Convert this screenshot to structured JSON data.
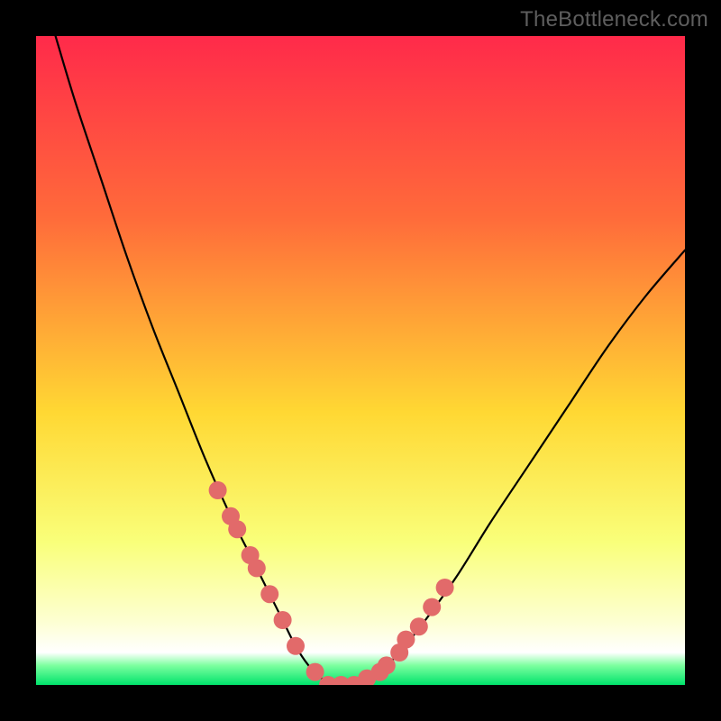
{
  "watermark": {
    "text": "TheBottleneck.com"
  },
  "colors": {
    "black": "#000000",
    "curve": "#000000",
    "marker_fill": "#e26a6a",
    "marker_stroke": "#d45a5a",
    "grad_top": "#ff2a4a",
    "grad_mid1": "#ff6b3a",
    "grad_mid2": "#ffd833",
    "grad_low": "#f9ff7a",
    "grad_pale": "#fdffd0",
    "green_edge": "#7cff9f",
    "green_core": "#00e36b"
  },
  "chart_data": {
    "type": "line",
    "title": "",
    "xlabel": "",
    "ylabel": "",
    "xlim": [
      0,
      100
    ],
    "ylim": [
      0,
      100
    ],
    "series": [
      {
        "name": "bottleneck-curve",
        "x": [
          3,
          6,
          10,
          14,
          18,
          22,
          26,
          30,
          33,
          36,
          38,
          40,
          42,
          44,
          46,
          48,
          50,
          53,
          56,
          60,
          65,
          70,
          76,
          82,
          88,
          94,
          100
        ],
        "y": [
          100,
          90,
          78,
          66,
          55,
          45,
          35,
          26,
          20,
          14,
          10,
          6,
          3,
          1,
          0,
          0,
          0,
          2,
          5,
          10,
          17,
          25,
          34,
          43,
          52,
          60,
          67
        ]
      }
    ],
    "markers": {
      "name": "highlight-points",
      "x": [
        28,
        30,
        31,
        33,
        34,
        36,
        38,
        40,
        43,
        45,
        47,
        49,
        51,
        53,
        54,
        56,
        57,
        59,
        61,
        63
      ],
      "y": [
        30,
        26,
        24,
        20,
        18,
        14,
        10,
        6,
        2,
        0,
        0,
        0,
        1,
        2,
        3,
        5,
        7,
        9,
        12,
        15
      ]
    },
    "green_band": {
      "y_from": 0,
      "y_to": 3
    }
  }
}
